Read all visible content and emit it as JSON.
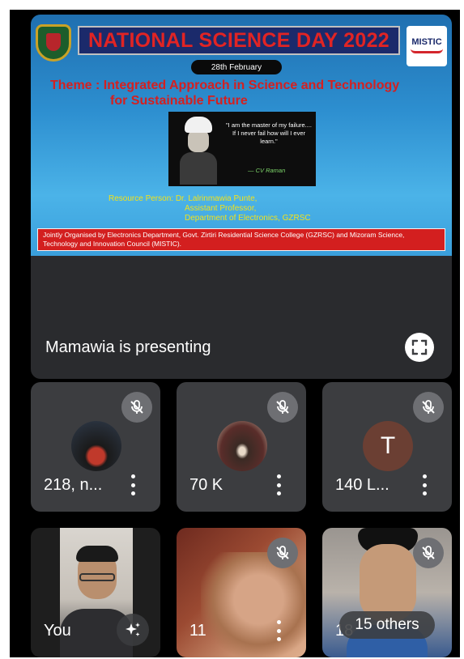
{
  "slide": {
    "title": "NATIONAL SCIENCE DAY 2022",
    "logo_right": "MISTIC",
    "date": "28th February",
    "theme_line1": "Theme : Integrated Approach in Science and Technology",
    "theme_line2": "for Sustainable Future",
    "quote": "\"I am the master of my failure.... If I never fail how will I ever learn.\"",
    "quote_author": "— CV Raman",
    "resource_line1": "Resource Person: Dr. Lalrinmawia Punte,",
    "resource_line2": "Assistant Professor,",
    "resource_line3": "Department of Electronics, GZRSC",
    "organiser": "Jointly Organised by Electronics Department, Govt. Zirtiri Residential Science College (GZRSC) and Mizoram Science, Technology and Innovation Council (MISTIC)."
  },
  "presenting": {
    "label": "Mamawia is presenting",
    "fullscreen_icon": "fullscreen-icon"
  },
  "participants": [
    {
      "name": "218, n...",
      "muted": true
    },
    {
      "name": "70 K",
      "muted": true
    },
    {
      "name": "140 L...",
      "muted": true,
      "avatar_letter": "T",
      "avatar_color": "#6b3f33"
    }
  ],
  "video_tiles": [
    {
      "name": "You"
    },
    {
      "name": "11",
      "muted": true
    },
    {
      "name": "18",
      "muted": true
    }
  ],
  "others": {
    "label": "15 others"
  },
  "colors": {
    "background": "#000000",
    "tile": "#3c3d40",
    "mute_badge": "#6e6f73"
  }
}
